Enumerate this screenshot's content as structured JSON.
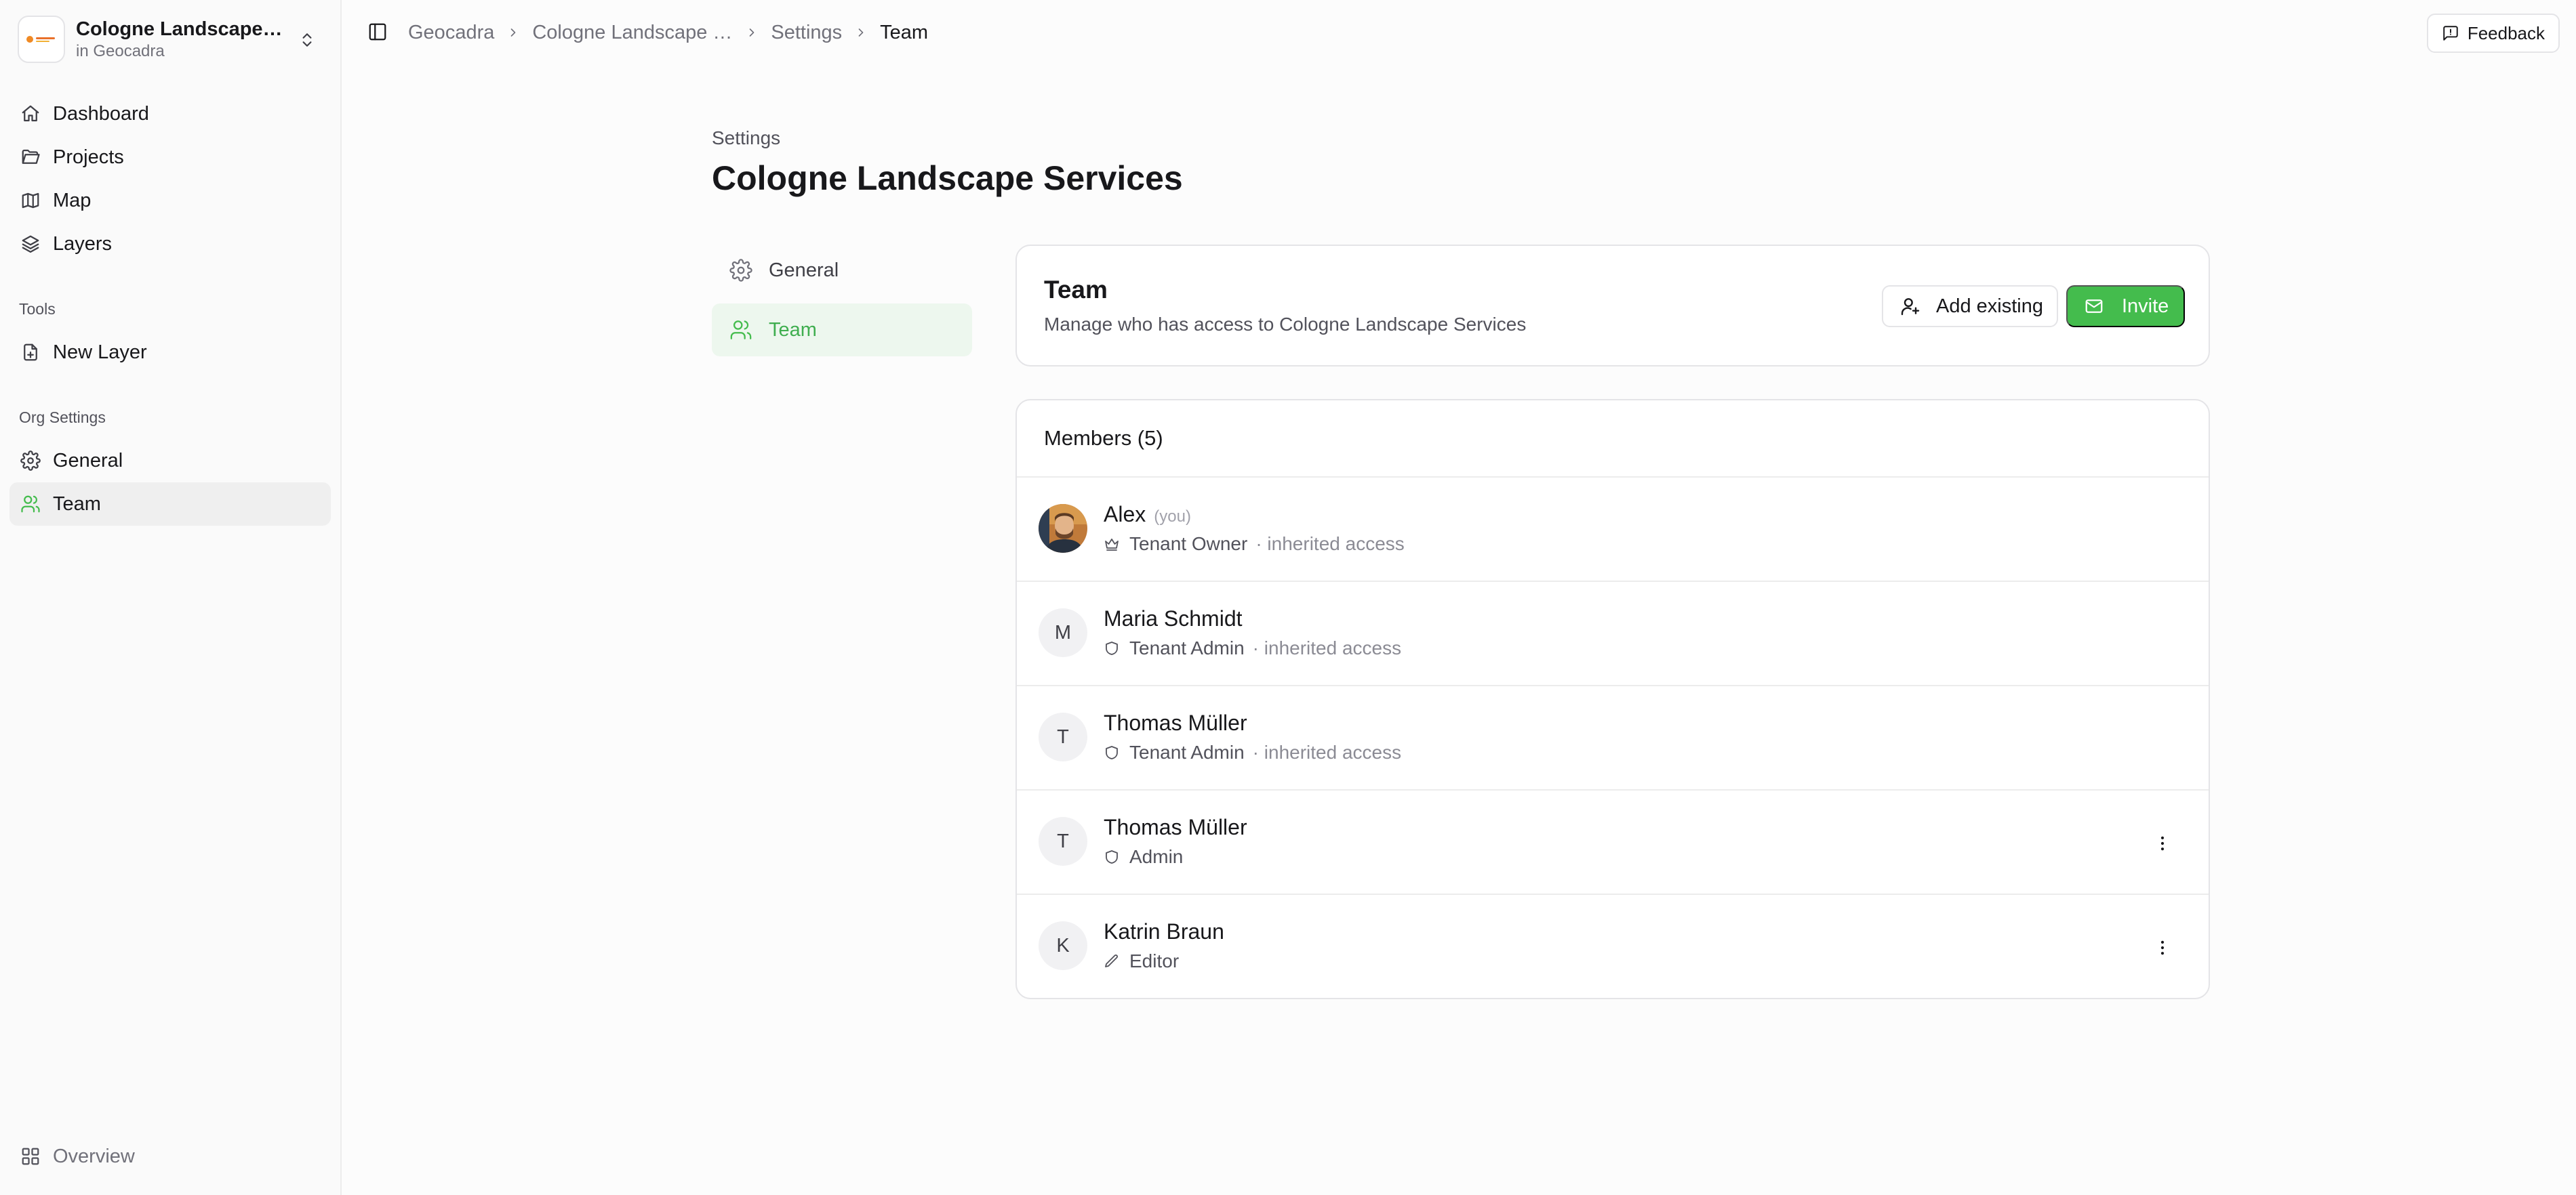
{
  "org": {
    "name": "Cologne Landscape Services",
    "subtitle": "in Geocadra"
  },
  "sidebar": {
    "nav": [
      {
        "label": "Dashboard",
        "icon": "home-icon"
      },
      {
        "label": "Projects",
        "icon": "folder-open-icon"
      },
      {
        "label": "Map",
        "icon": "map-icon"
      },
      {
        "label": "Layers",
        "icon": "layers-icon"
      }
    ],
    "tools_label": "Tools",
    "tools": [
      {
        "label": "New Layer",
        "icon": "file-plus-icon"
      }
    ],
    "org_settings_label": "Org Settings",
    "org_settings": [
      {
        "label": "General",
        "icon": "gear-icon"
      },
      {
        "label": "Team",
        "icon": "users-icon",
        "active": true
      }
    ],
    "footer": {
      "label": "Overview",
      "icon": "grid-icon"
    }
  },
  "breadcrumb": [
    "Geocadra",
    "Cologne Landscape Services",
    "Settings",
    "Team"
  ],
  "feedback_label": "Feedback",
  "page": {
    "eyebrow": "Settings",
    "title": "Cologne Landscape Services"
  },
  "settings_nav": [
    {
      "label": "General",
      "icon": "gear-icon"
    },
    {
      "label": "Team",
      "icon": "users-icon",
      "active": true
    }
  ],
  "team_card": {
    "title": "Team",
    "description": "Manage who has access to Cologne Landscape Services",
    "add_existing_label": "Add existing",
    "invite_label": "Invite"
  },
  "members": {
    "header": "Members (5)",
    "you_tag": "(you)",
    "list": [
      {
        "name": "Alex",
        "initial": "",
        "role": "Tenant Owner",
        "role_icon": "crown-icon",
        "access": "· inherited access",
        "is_you": true,
        "has_menu": false
      },
      {
        "name": "Maria Schmidt",
        "initial": "M",
        "role": "Tenant Admin",
        "role_icon": "shield-icon",
        "access": "· inherited access",
        "is_you": false,
        "has_menu": false
      },
      {
        "name": "Thomas Müller",
        "initial": "T",
        "role": "Tenant Admin",
        "role_icon": "shield-icon",
        "access": "· inherited access",
        "is_you": false,
        "has_menu": false
      },
      {
        "name": "Thomas Müller",
        "initial": "T",
        "role": "Admin",
        "role_icon": "shield-icon",
        "access": "",
        "is_you": false,
        "has_menu": true
      },
      {
        "name": "Katrin Braun",
        "initial": "K",
        "role": "Editor",
        "role_icon": "pencil-icon",
        "access": "",
        "is_you": false,
        "has_menu": true
      }
    ]
  },
  "colors": {
    "accent": "#44bc4d",
    "accent_text": "#3fae4f",
    "accent_bg": "#edf7ee",
    "border": "#e4e4e7"
  }
}
